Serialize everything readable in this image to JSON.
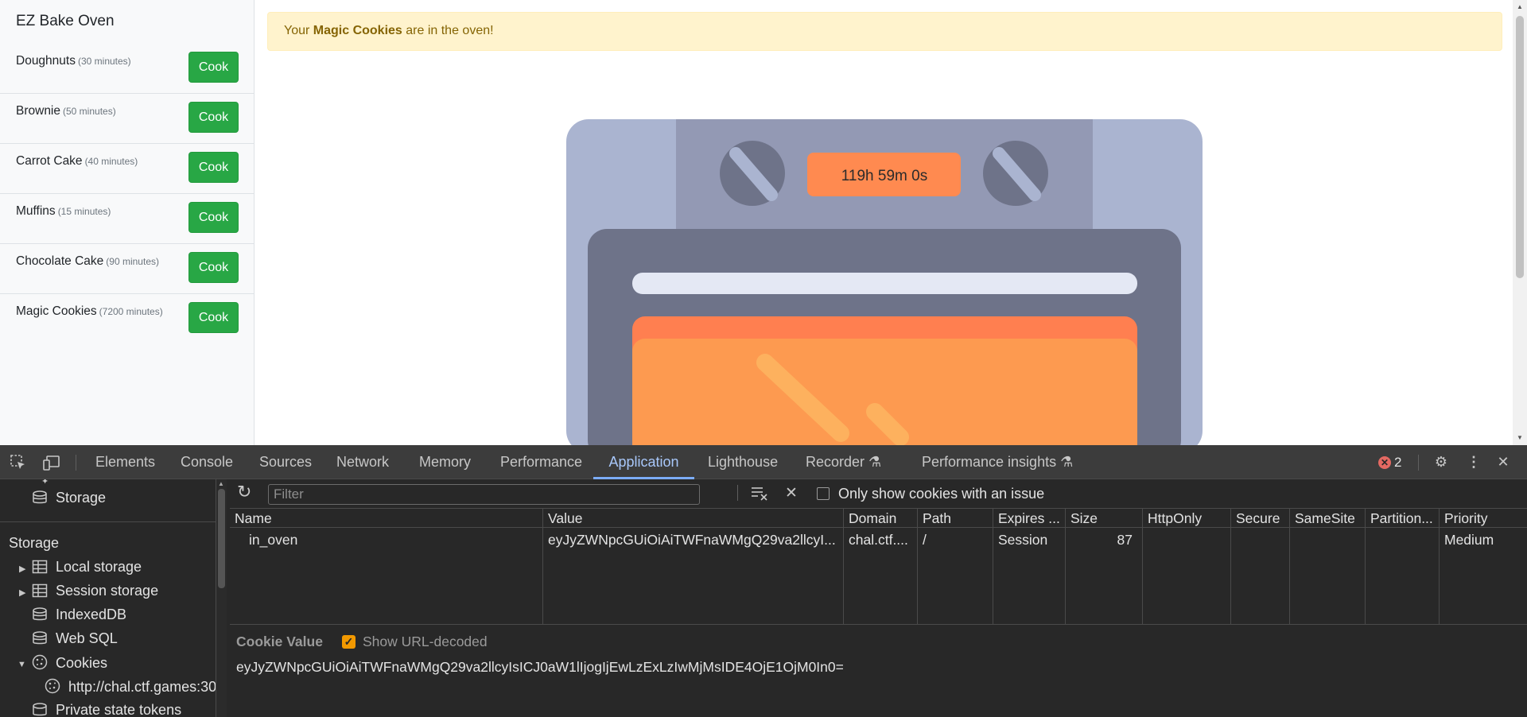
{
  "app": {
    "title": "EZ Bake Oven",
    "recipes": [
      {
        "name": "Doughnuts",
        "time": "(30 minutes)",
        "button": "Cook"
      },
      {
        "name": "Brownie",
        "time": "(50 minutes)",
        "button": "Cook"
      },
      {
        "name": "Carrot Cake",
        "time": "(40 minutes)",
        "button": "Cook"
      },
      {
        "name": "Muffins",
        "time": "(15 minutes)",
        "button": "Cook"
      },
      {
        "name": "Chocolate Cake",
        "time": "(90 minutes)",
        "button": "Cook"
      },
      {
        "name": "Magic Cookies",
        "time": "(7200 minutes)",
        "button": "Cook"
      }
    ],
    "alert": {
      "prefix": "Your ",
      "item": "Magic Cookies",
      "suffix": " are in the oven!"
    },
    "timer": "119h 59m 0s"
  },
  "devtools": {
    "tabs": [
      "Elements",
      "Console",
      "Sources",
      "Network",
      "Memory",
      "Performance",
      "Application",
      "Lighthouse",
      "Recorder",
      "Performance insights"
    ],
    "active_tab": "Application",
    "error_count": "2",
    "tree": {
      "storage_item": "Storage",
      "section_title": "Storage",
      "local_storage": "Local storage",
      "session_storage": "Session storage",
      "indexeddb": "IndexedDB",
      "web_sql": "Web SQL",
      "cookies": "Cookies",
      "cookie_origin": "http://chal.ctf.games:30",
      "private_state_tokens": "Private state tokens"
    },
    "cookies": {
      "filter_placeholder": "Filter",
      "only_issues_label": "Only show cookies with an issue",
      "columns": [
        "Name",
        "Value",
        "Domain",
        "Path",
        "Expires ...",
        "Size",
        "HttpOnly",
        "Secure",
        "SameSite",
        "Partition...",
        "Priority"
      ],
      "row": {
        "name": "in_oven",
        "value": "eyJyZWNpcGUiOiAiTWFnaWMgQ29va2llcyI...",
        "domain": "chal.ctf....",
        "path": "/",
        "expires": "Session",
        "size": "87",
        "httponly": "",
        "secure": "",
        "samesite": "",
        "partition": "",
        "priority": "Medium"
      },
      "value_panel": {
        "title": "Cookie Value",
        "show_decoded_label": "Show URL-decoded",
        "show_decoded_checked": true,
        "value": "eyJyZWNpcGUiOiAiTWFnaWMgQ29va2llcyIsICJ0aW1lIjogIjEwLzExLzIwMjMsIDE4OjE1OjM0In0="
      }
    }
  },
  "colors": {
    "cook_button": "#28a745",
    "alert_bg": "#fff3cd",
    "timer_bg": "#ff8a50",
    "oven_outer": "#aab4d0",
    "oven_panel": "#9399b4",
    "oven_door": "#6e7389",
    "devtools_bg": "#282828",
    "active_tab": "#a8c7fa"
  }
}
